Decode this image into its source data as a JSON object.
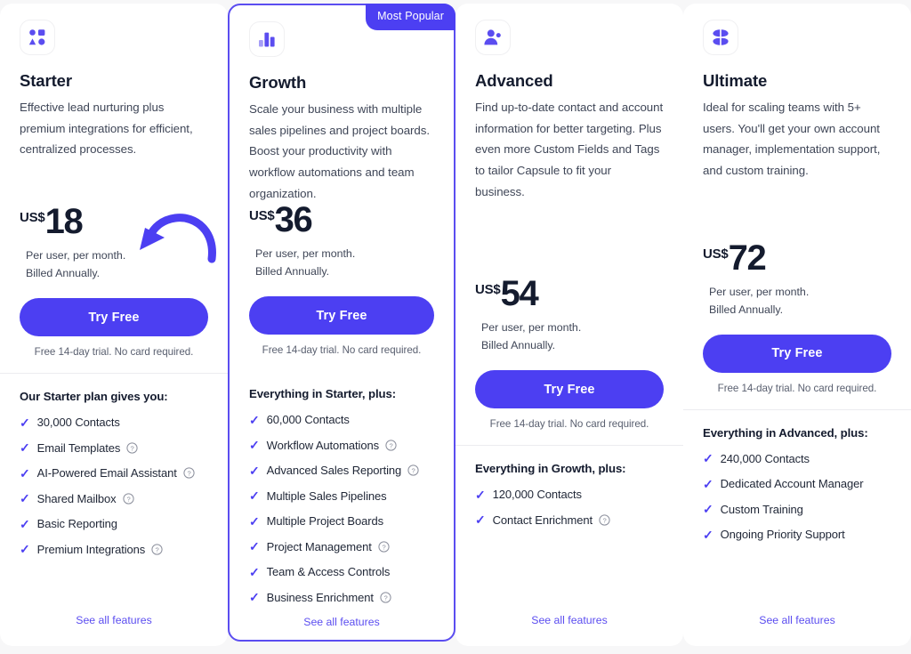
{
  "theme": {
    "accent": "#4c3ff2",
    "featured_border": "#5b4df0",
    "page_bg": "#f7f7f8",
    "heading_color": "#141b2e",
    "body_color": "#3f4657",
    "link_color": "#5b4df0"
  },
  "annotations": {
    "arrow": "curved-arrow-pointing-to-starter-cta"
  },
  "plans": [
    {
      "id": "starter",
      "icon": "shapes-grid-icon",
      "name": "Starter",
      "blurb": "Effective lead nurturing plus premium integrations for efficient, centralized processes.",
      "badge": null,
      "currency": "US$",
      "price": "18",
      "note_line1": "Per user, per month.",
      "note_line2": "Billed Annually.",
      "cta_label": "Try Free",
      "cta_sub": "Free 14-day trial. No card required.",
      "features_heading": "Our Starter plan gives you:",
      "features": [
        {
          "label": "30,000 Contacts",
          "help": false
        },
        {
          "label": "Email Templates",
          "help": true
        },
        {
          "label": "AI-Powered Email Assistant",
          "help": true
        },
        {
          "label": "Shared Mailbox",
          "help": true
        },
        {
          "label": "Basic Reporting",
          "help": false
        },
        {
          "label": "Premium Integrations",
          "help": true
        }
      ],
      "see_all_label": "See all features"
    },
    {
      "id": "growth",
      "icon": "bar-chart-icon",
      "name": "Growth",
      "blurb": "Scale your business with multiple sales pipelines and project boards. Boost your productivity with workflow automations and team organization.",
      "badge": "Most Popular",
      "currency": "US$",
      "price": "36",
      "note_line1": "Per user, per month.",
      "note_line2": "Billed Annually.",
      "cta_label": "Try Free",
      "cta_sub": "Free 14-day trial. No card required.",
      "features_heading": "Everything in Starter, plus:",
      "features": [
        {
          "label": "60,000 Contacts",
          "help": false
        },
        {
          "label": "Workflow Automations",
          "help": true
        },
        {
          "label": "Advanced Sales Reporting",
          "help": true
        },
        {
          "label": "Multiple Sales Pipelines",
          "help": false
        },
        {
          "label": "Multiple Project Boards",
          "help": false
        },
        {
          "label": "Project Management",
          "help": true
        },
        {
          "label": "Team & Access Controls",
          "help": false
        },
        {
          "label": "Business Enrichment",
          "help": true
        }
      ],
      "see_all_label": "See all features"
    },
    {
      "id": "advanced",
      "icon": "users-icon",
      "name": "Advanced",
      "blurb": "Find up-to-date contact and account information for better targeting. Plus even more Custom Fields and Tags to tailor Capsule to fit your business.",
      "badge": null,
      "currency": "US$",
      "price": "54",
      "note_line1": "Per user, per month.",
      "note_line2": "Billed Annually.",
      "cta_label": "Try Free",
      "cta_sub": "Free 14-day trial. No card required.",
      "features_heading": "Everything in Growth, plus:",
      "features": [
        {
          "label": "120,000 Contacts",
          "help": false
        },
        {
          "label": "Contact Enrichment",
          "help": true
        }
      ],
      "see_all_label": "See all features"
    },
    {
      "id": "ultimate",
      "icon": "four-petals-icon",
      "name": "Ultimate",
      "blurb": "Ideal for scaling teams with 5+ users. You'll get your own account manager, implementation support, and custom training.",
      "badge": null,
      "currency": "US$",
      "price": "72",
      "note_line1": "Per user, per month.",
      "note_line2": "Billed Annually.",
      "cta_label": "Try Free",
      "cta_sub": "Free 14-day trial. No card required.",
      "features_heading": "Everything in Advanced, plus:",
      "features": [
        {
          "label": "240,000 Contacts",
          "help": false
        },
        {
          "label": "Dedicated Account Manager",
          "help": false
        },
        {
          "label": "Custom Training",
          "help": false
        },
        {
          "label": "Ongoing Priority Support",
          "help": false
        }
      ],
      "see_all_label": "See all features"
    }
  ]
}
